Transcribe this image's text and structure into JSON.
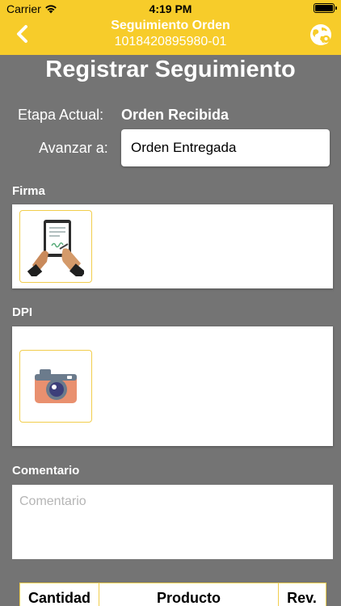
{
  "status": {
    "carrier": "Carrier",
    "time": "4:19 PM"
  },
  "nav": {
    "title_line1": "Seguimiento Orden",
    "title_line2": "1018420895980-01",
    "back_icon": "chevron-left-icon",
    "globe_icon": "globe-icon"
  },
  "page": {
    "heading": "Registrar Seguimiento"
  },
  "stage": {
    "label": "Etapa Actual:",
    "value": "Orden Recibida"
  },
  "advance": {
    "label": "Avanzar a:",
    "value": "Orden Entregada"
  },
  "signature": {
    "label": "Firma",
    "icon": "signature-icon"
  },
  "dpi": {
    "label": "DPI",
    "icon": "camera-icon"
  },
  "comment": {
    "label": "Comentario",
    "placeholder": "Comentario"
  },
  "table": {
    "columns": [
      "Cantidad",
      "Producto",
      "Rev."
    ]
  },
  "colors": {
    "accent": "#f7cc2a",
    "background": "#747474",
    "border": "#f1cd4c"
  }
}
